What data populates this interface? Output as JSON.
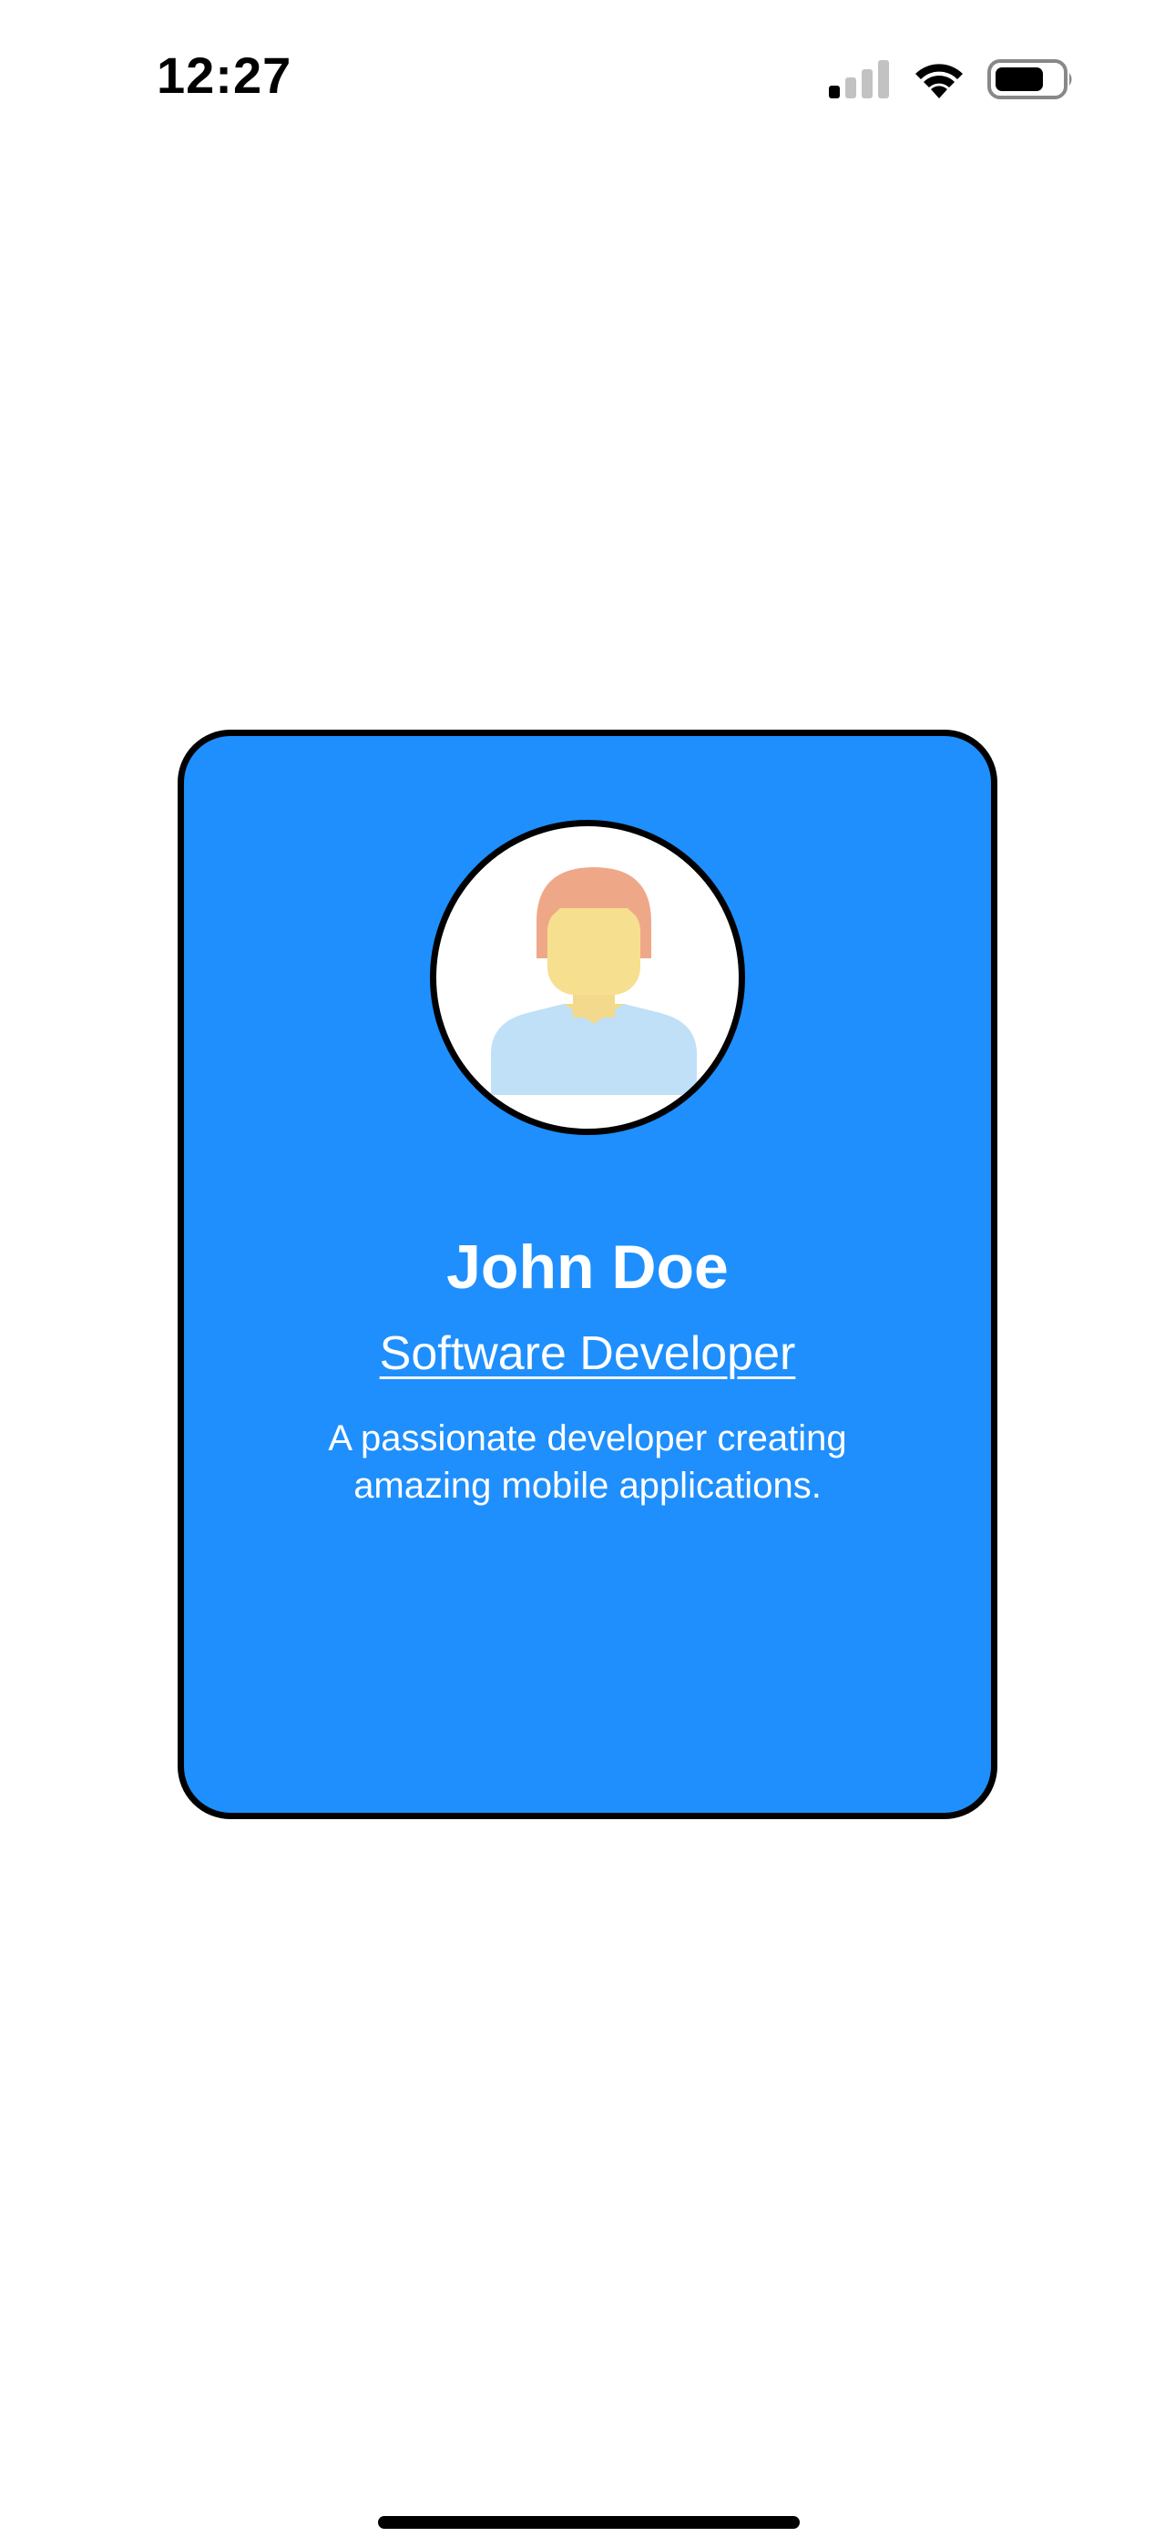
{
  "status_bar": {
    "time": "12:27",
    "icons": [
      "cellular-signal-icon",
      "wifi-icon",
      "battery-icon"
    ]
  },
  "profile": {
    "name": "John Doe",
    "title": "Software Developer",
    "bio": "A passionate developer creating amazing mobile applications.",
    "avatar_icon": "user-avatar-icon"
  },
  "colors": {
    "card_background": "#1e8ffd",
    "card_border": "#000000",
    "text": "#ffffff"
  }
}
